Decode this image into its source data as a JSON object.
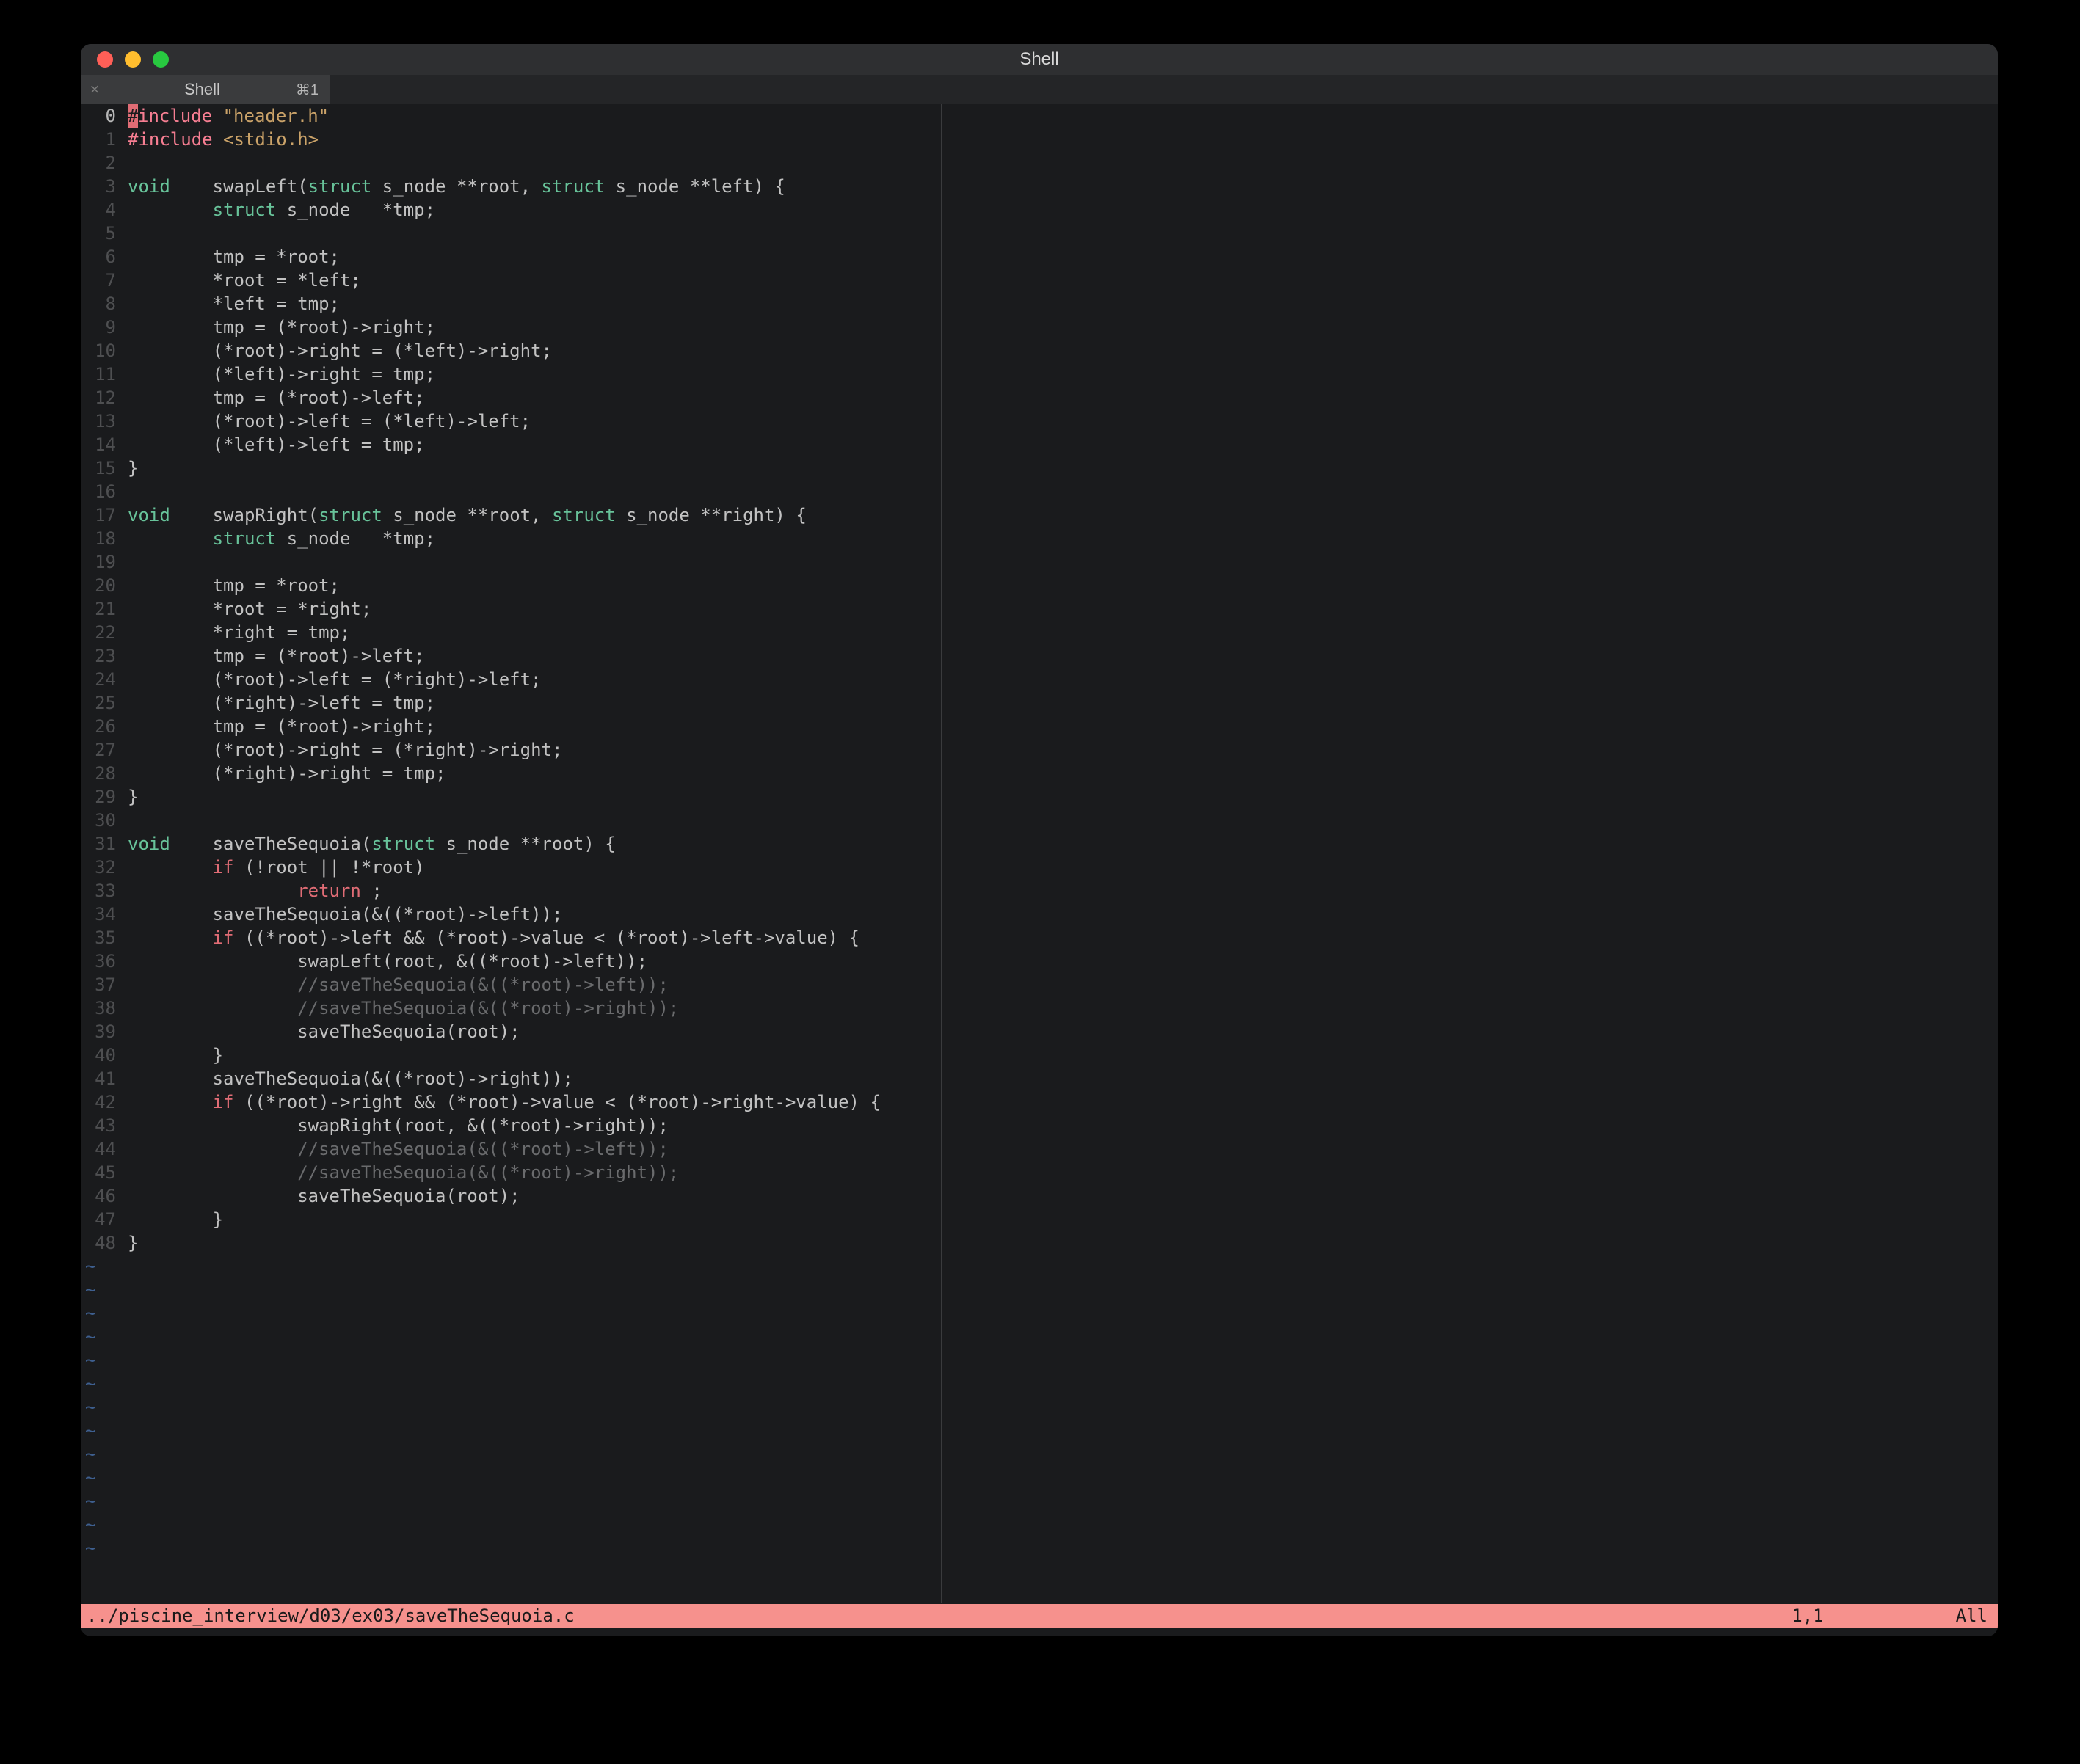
{
  "window": {
    "title": "Shell"
  },
  "tab": {
    "close_glyph": "×",
    "title": "Shell",
    "shortcut": "⌘1"
  },
  "colors": {
    "statusbar_bg": "#f6918d",
    "cursor_bg": "#e06c75"
  },
  "code_lines": [
    {
      "n": 0,
      "current": true,
      "segs": [
        {
          "cls": "cursor-cell",
          "t": "#"
        },
        {
          "cls": "k-preproc",
          "t": "include"
        },
        {
          "cls": "",
          "t": " "
        },
        {
          "cls": "k-string",
          "t": "\"header.h\""
        }
      ]
    },
    {
      "n": 1,
      "segs": [
        {
          "cls": "k-preproc",
          "t": "#include"
        },
        {
          "cls": "",
          "t": " "
        },
        {
          "cls": "k-string",
          "t": "<stdio.h>"
        }
      ]
    },
    {
      "n": 2,
      "segs": []
    },
    {
      "n": 3,
      "segs": [
        {
          "cls": "k-type",
          "t": "void"
        },
        {
          "cls": "",
          "t": "    swapLeft("
        },
        {
          "cls": "k-type",
          "t": "struct"
        },
        {
          "cls": "",
          "t": " s_node **root, "
        },
        {
          "cls": "k-type",
          "t": "struct"
        },
        {
          "cls": "",
          "t": " s_node **left) {"
        }
      ]
    },
    {
      "n": 4,
      "segs": [
        {
          "cls": "",
          "t": "        "
        },
        {
          "cls": "k-type",
          "t": "struct"
        },
        {
          "cls": "",
          "t": " s_node   *tmp;"
        }
      ]
    },
    {
      "n": 5,
      "segs": []
    },
    {
      "n": 6,
      "segs": [
        {
          "cls": "",
          "t": "        tmp = *root;"
        }
      ]
    },
    {
      "n": 7,
      "segs": [
        {
          "cls": "",
          "t": "        *root = *left;"
        }
      ]
    },
    {
      "n": 8,
      "segs": [
        {
          "cls": "",
          "t": "        *left = tmp;"
        }
      ]
    },
    {
      "n": 9,
      "segs": [
        {
          "cls": "",
          "t": "        tmp = (*root)->right;"
        }
      ]
    },
    {
      "n": 10,
      "segs": [
        {
          "cls": "",
          "t": "        (*root)->right = (*left)->right;"
        }
      ]
    },
    {
      "n": 11,
      "segs": [
        {
          "cls": "",
          "t": "        (*left)->right = tmp;"
        }
      ]
    },
    {
      "n": 12,
      "segs": [
        {
          "cls": "",
          "t": "        tmp = (*root)->left;"
        }
      ]
    },
    {
      "n": 13,
      "segs": [
        {
          "cls": "",
          "t": "        (*root)->left = (*left)->left;"
        }
      ]
    },
    {
      "n": 14,
      "segs": [
        {
          "cls": "",
          "t": "        (*left)->left = tmp;"
        }
      ]
    },
    {
      "n": 15,
      "segs": [
        {
          "cls": "",
          "t": "}"
        }
      ]
    },
    {
      "n": 16,
      "segs": []
    },
    {
      "n": 17,
      "segs": [
        {
          "cls": "k-type",
          "t": "void"
        },
        {
          "cls": "",
          "t": "    swapRight("
        },
        {
          "cls": "k-type",
          "t": "struct"
        },
        {
          "cls": "",
          "t": " s_node **root, "
        },
        {
          "cls": "k-type",
          "t": "struct"
        },
        {
          "cls": "",
          "t": " s_node **right) {"
        }
      ]
    },
    {
      "n": 18,
      "segs": [
        {
          "cls": "",
          "t": "        "
        },
        {
          "cls": "k-type",
          "t": "struct"
        },
        {
          "cls": "",
          "t": " s_node   *tmp;"
        }
      ]
    },
    {
      "n": 19,
      "segs": []
    },
    {
      "n": 20,
      "segs": [
        {
          "cls": "",
          "t": "        tmp = *root;"
        }
      ]
    },
    {
      "n": 21,
      "segs": [
        {
          "cls": "",
          "t": "        *root = *right;"
        }
      ]
    },
    {
      "n": 22,
      "segs": [
        {
          "cls": "",
          "t": "        *right = tmp;"
        }
      ]
    },
    {
      "n": 23,
      "segs": [
        {
          "cls": "",
          "t": "        tmp = (*root)->left;"
        }
      ]
    },
    {
      "n": 24,
      "segs": [
        {
          "cls": "",
          "t": "        (*root)->left = (*right)->left;"
        }
      ]
    },
    {
      "n": 25,
      "segs": [
        {
          "cls": "",
          "t": "        (*right)->left = tmp;"
        }
      ]
    },
    {
      "n": 26,
      "segs": [
        {
          "cls": "",
          "t": "        tmp = (*root)->right;"
        }
      ]
    },
    {
      "n": 27,
      "segs": [
        {
          "cls": "",
          "t": "        (*root)->right = (*right)->right;"
        }
      ]
    },
    {
      "n": 28,
      "segs": [
        {
          "cls": "",
          "t": "        (*right)->right = tmp;"
        }
      ]
    },
    {
      "n": 29,
      "segs": [
        {
          "cls": "",
          "t": "}"
        }
      ]
    },
    {
      "n": 30,
      "segs": []
    },
    {
      "n": 31,
      "segs": [
        {
          "cls": "k-type",
          "t": "void"
        },
        {
          "cls": "",
          "t": "    saveTheSequoia("
        },
        {
          "cls": "k-type",
          "t": "struct"
        },
        {
          "cls": "",
          "t": " s_node **root) {"
        }
      ]
    },
    {
      "n": 32,
      "segs": [
        {
          "cls": "",
          "t": "        "
        },
        {
          "cls": "k-flow",
          "t": "if"
        },
        {
          "cls": "",
          "t": " (!root || !*root)"
        }
      ]
    },
    {
      "n": 33,
      "segs": [
        {
          "cls": "",
          "t": "                "
        },
        {
          "cls": "k-flow",
          "t": "return"
        },
        {
          "cls": "",
          "t": " ;"
        }
      ]
    },
    {
      "n": 34,
      "segs": [
        {
          "cls": "",
          "t": "        saveTheSequoia(&((*root)->left));"
        }
      ]
    },
    {
      "n": 35,
      "segs": [
        {
          "cls": "",
          "t": "        "
        },
        {
          "cls": "k-flow",
          "t": "if"
        },
        {
          "cls": "",
          "t": " ((*root)->left && (*root)->value < (*root)->left->value) {"
        }
      ]
    },
    {
      "n": 36,
      "segs": [
        {
          "cls": "",
          "t": "                swapLeft(root, &((*root)->left));"
        }
      ]
    },
    {
      "n": 37,
      "segs": [
        {
          "cls": "",
          "t": "                "
        },
        {
          "cls": "k-comment",
          "t": "//saveTheSequoia(&((*root)->left));"
        }
      ]
    },
    {
      "n": 38,
      "segs": [
        {
          "cls": "",
          "t": "                "
        },
        {
          "cls": "k-comment",
          "t": "//saveTheSequoia(&((*root)->right));"
        }
      ]
    },
    {
      "n": 39,
      "segs": [
        {
          "cls": "",
          "t": "                saveTheSequoia(root);"
        }
      ]
    },
    {
      "n": 40,
      "segs": [
        {
          "cls": "",
          "t": "        }"
        }
      ]
    },
    {
      "n": 41,
      "segs": [
        {
          "cls": "",
          "t": "        saveTheSequoia(&((*root)->right));"
        }
      ]
    },
    {
      "n": 42,
      "segs": [
        {
          "cls": "",
          "t": "        "
        },
        {
          "cls": "k-flow",
          "t": "if"
        },
        {
          "cls": "",
          "t": " ((*root)->right && (*root)->value < (*root)->right->value) {"
        }
      ]
    },
    {
      "n": 43,
      "segs": [
        {
          "cls": "",
          "t": "                swapRight(root, &((*root)->right));"
        }
      ]
    },
    {
      "n": 44,
      "segs": [
        {
          "cls": "",
          "t": "                "
        },
        {
          "cls": "k-comment",
          "t": "//saveTheSequoia(&((*root)->left));"
        }
      ]
    },
    {
      "n": 45,
      "segs": [
        {
          "cls": "",
          "t": "                "
        },
        {
          "cls": "k-comment",
          "t": "//saveTheSequoia(&((*root)->right));"
        }
      ]
    },
    {
      "n": 46,
      "segs": [
        {
          "cls": "",
          "t": "                saveTheSequoia(root);"
        }
      ]
    },
    {
      "n": 47,
      "segs": [
        {
          "cls": "",
          "t": "        }"
        }
      ]
    },
    {
      "n": 48,
      "segs": [
        {
          "cls": "",
          "t": "}"
        }
      ]
    }
  ],
  "tilde_count": 13,
  "tilde_glyph": "~",
  "status": {
    "file": "../piscine_interview/d03/ex03/saveTheSequoia.c",
    "position": "1,1",
    "percent": "All"
  }
}
